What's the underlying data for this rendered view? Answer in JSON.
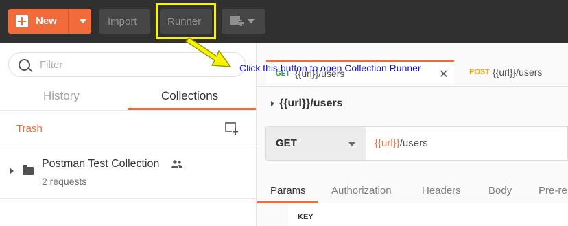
{
  "toolbar": {
    "new_label": "New",
    "import_label": "Import",
    "runner_label": "Runner"
  },
  "sidebar": {
    "search_placeholder": "Filter",
    "tabs": [
      {
        "label": "History",
        "active": false
      },
      {
        "label": "Collections",
        "active": true
      }
    ],
    "trash_label": "Trash",
    "collection": {
      "name": "Postman Test Collection",
      "subtitle": "2 requests"
    }
  },
  "main": {
    "request_tabs": [
      {
        "method": "GET",
        "url": "{{url}}/users",
        "active": true
      },
      {
        "method": "POST",
        "url": "{{url}}/users",
        "active": false
      }
    ],
    "request_name": "{{url}}/users",
    "method": "GET",
    "url_var": "{{url}}",
    "url_path": "/users",
    "sub_tabs": [
      "Params",
      "Authorization",
      "Headers",
      "Body",
      "Pre-re"
    ],
    "params_key_header": "KEY"
  },
  "annotation": {
    "text": "Click this button to open Collection Runner",
    "color": "#1010e0",
    "highlight_color": "#f8f400"
  },
  "colors": {
    "accent": "#f26b3a",
    "topbar": "#303030"
  }
}
